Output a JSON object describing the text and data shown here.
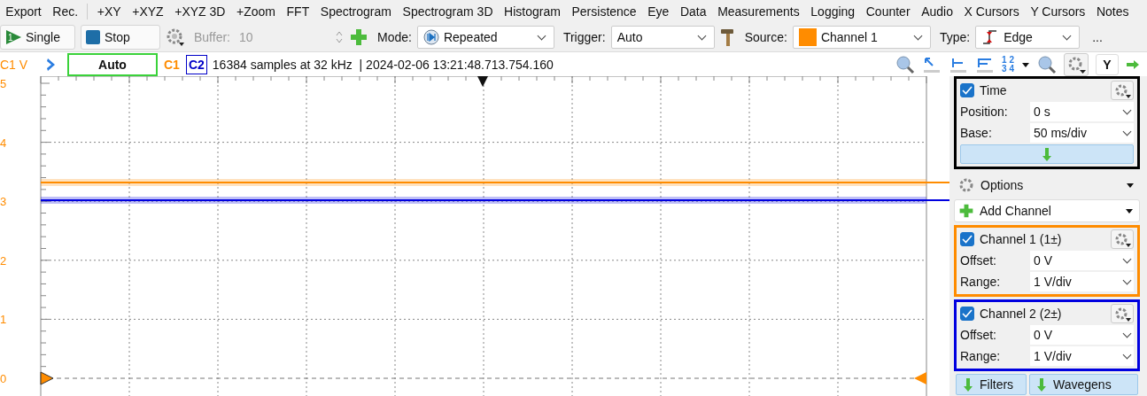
{
  "menu_groups": [
    [
      "Export",
      "Rec."
    ],
    [
      "+XY",
      "+XYZ",
      "+XYZ 3D",
      "+Zoom",
      "FFT",
      "Spectrogram",
      "Spectrogram 3D",
      "Histogram",
      "Persistence",
      "Eye",
      "Data",
      "Measurements",
      "Logging",
      "Counter",
      "Audio",
      "X Cursors",
      "Y Cursors",
      "Notes"
    ]
  ],
  "toolbar": {
    "single": "Single",
    "single_badge": "1",
    "stop": "Stop",
    "buffer": {
      "label": "Buffer:",
      "value": "10",
      "disabled": true
    },
    "mode": {
      "label": "Mode:",
      "value": "Repeated"
    },
    "trigger": {
      "label": "Trigger:",
      "value": "Auto"
    },
    "source": {
      "label": "Source:",
      "value": "Channel 1",
      "color": "#ff8c00"
    },
    "type": {
      "label": "Type:",
      "value": "Edge"
    },
    "more": "..."
  },
  "plot_header": {
    "trigger_status": "Auto",
    "channel_tags": [
      {
        "label": "C1",
        "boxed": false,
        "color": "#ff8c00"
      },
      {
        "label": "C2",
        "boxed": true,
        "color": "#0000c8"
      }
    ],
    "info": "16384 samples at 32 kHz  | 2024-02-06 13:21:48.713.754.160",
    "numbering_icon": [
      "1 2",
      "3 4"
    ],
    "axis_button": "Y"
  },
  "plot": {
    "unit_label": "C1 V",
    "tick_labels": [
      "5",
      "4",
      "3",
      "2",
      "1",
      "0"
    ]
  },
  "panel": {
    "time": {
      "title": "Time",
      "checked": true,
      "fields": [
        {
          "label": "Position:",
          "value": "0 s"
        },
        {
          "label": "Base:",
          "value": "50 ms/div"
        }
      ]
    },
    "options": "Options",
    "add_channel": "Add Channel",
    "channels": [
      {
        "title": "Channel 1 (1±)",
        "checked": true,
        "color": "#ff8c00",
        "fields": [
          {
            "label": "Offset:",
            "value": "0 V"
          },
          {
            "label": "Range:",
            "value": "1 V/div"
          }
        ]
      },
      {
        "title": "Channel 2 (2±)",
        "checked": true,
        "color": "#0000e0",
        "fields": [
          {
            "label": "Offset:",
            "value": "0 V"
          },
          {
            "label": "Range:",
            "value": "1 V/div"
          }
        ]
      }
    ],
    "bottom_buttons": [
      "Filters",
      "Wavegens"
    ]
  }
}
